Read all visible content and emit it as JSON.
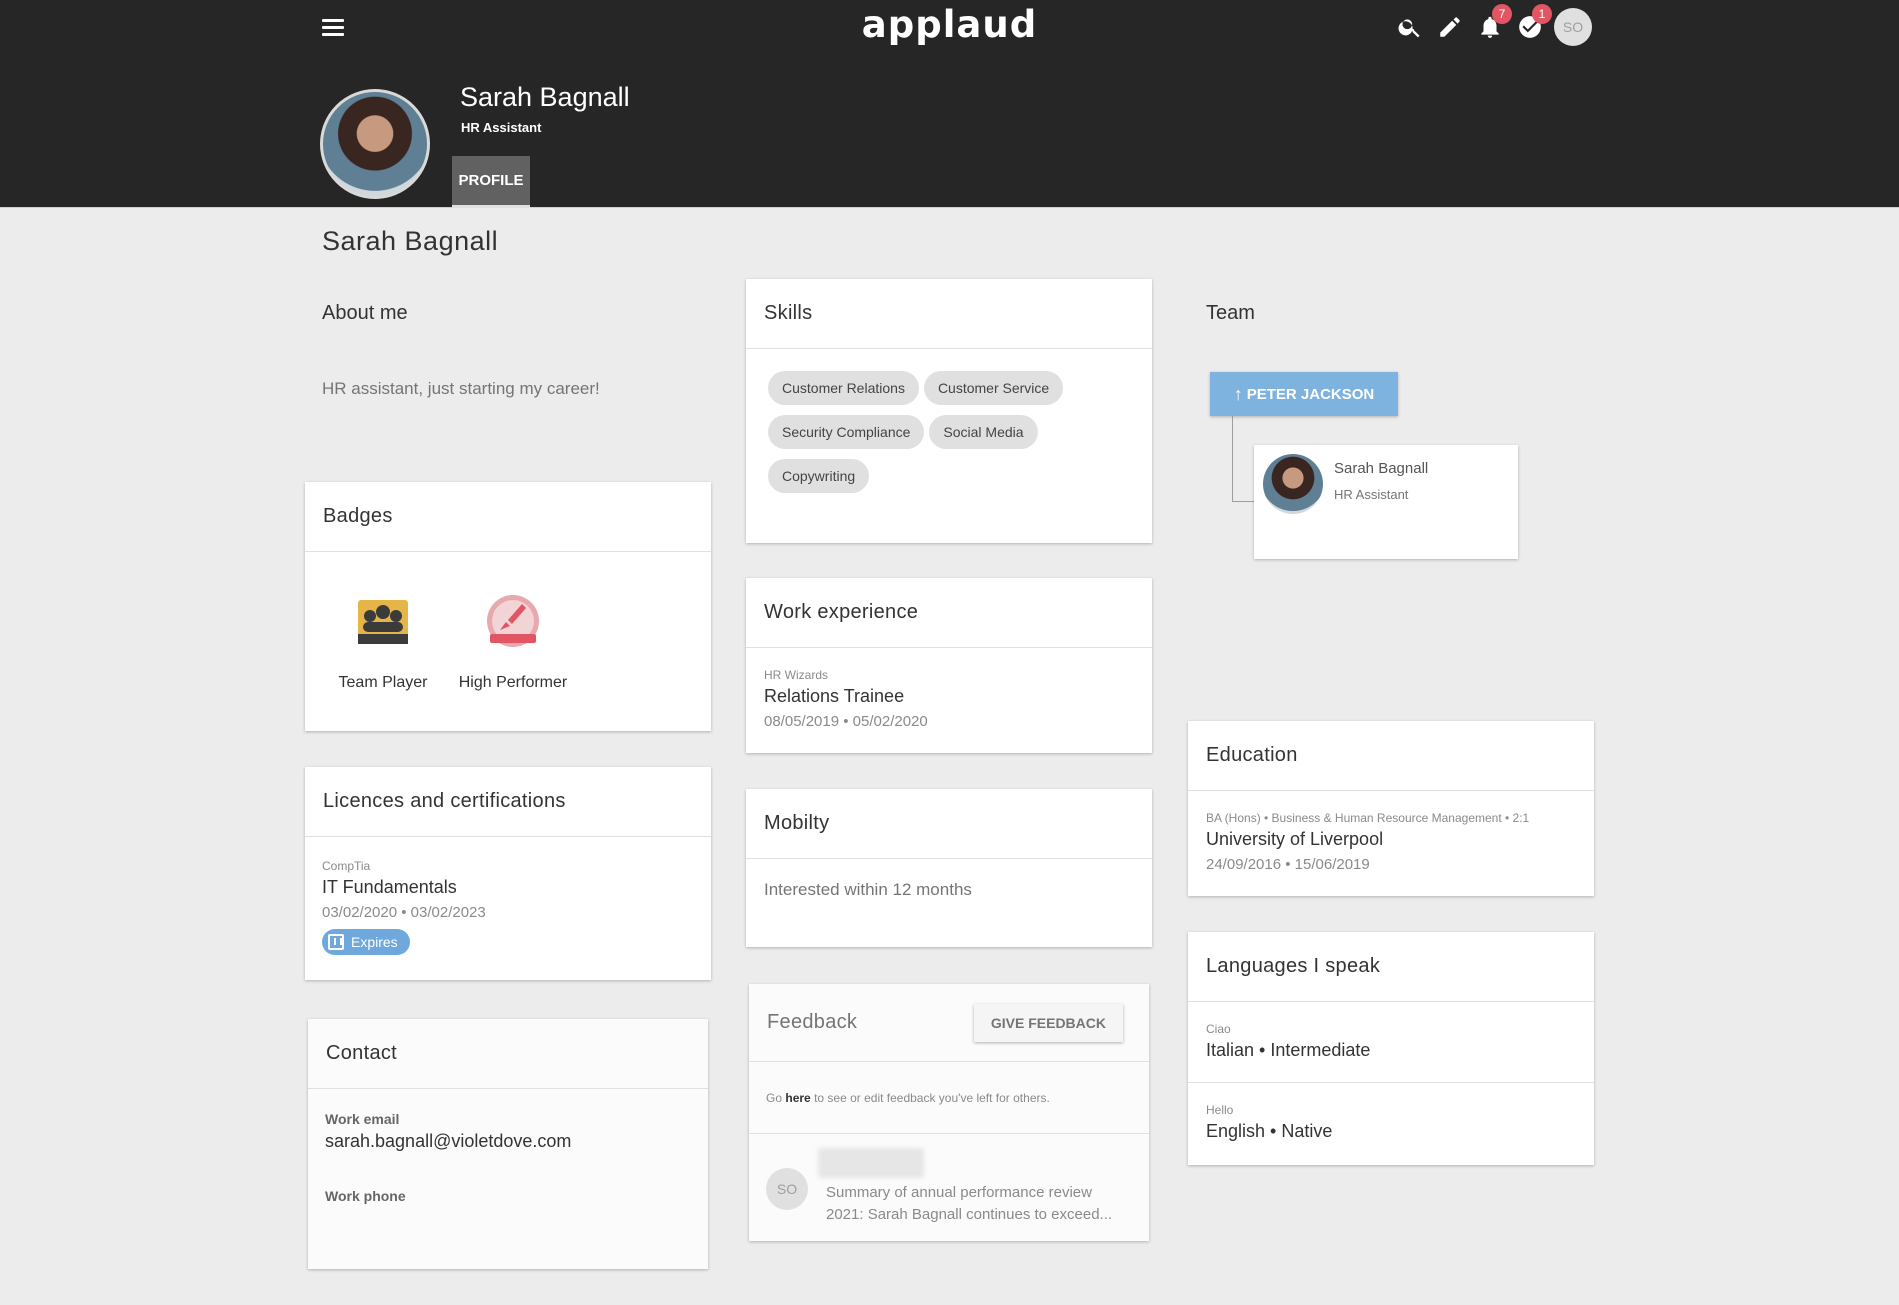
{
  "header": {
    "logo": "applaud",
    "notifications_count": "7",
    "tasks_count": "1",
    "user_initials": "SO"
  },
  "profile": {
    "name": "Sarah Bagnall",
    "role": "HR Assistant",
    "tab_label": "PROFILE"
  },
  "page_title": "Sarah Bagnall",
  "about": {
    "title": "About me",
    "text": "HR assistant, just starting my career!"
  },
  "badges": {
    "title": "Badges",
    "items": [
      {
        "label": "Team Player"
      },
      {
        "label": "High Performer"
      }
    ]
  },
  "licences": {
    "title": "Licences and certifications",
    "issuer": "CompTia",
    "name": "IT Fundamentals",
    "dates": "03/02/2020 • 03/02/2023",
    "pill": "Expires"
  },
  "contact": {
    "title": "Contact",
    "email_label": "Work email",
    "email": "sarah.bagnall@violetdove.com",
    "phone_label": "Work phone"
  },
  "skills": {
    "title": "Skills",
    "items": [
      "Customer Relations",
      "Customer Service",
      "Security Compliance",
      "Social Media",
      "Copywriting"
    ]
  },
  "work": {
    "title": "Work experience",
    "company": "HR Wizards",
    "position": "Relations Trainee",
    "dates": "08/05/2019 • 05/02/2020"
  },
  "mobility": {
    "title": "Mobilty",
    "text": "Interested within 12 months"
  },
  "feedback": {
    "title": "Feedback",
    "button": "GIVE FEEDBACK",
    "hint_prefix": "Go ",
    "hint_link": "here",
    "hint_suffix": " to see or edit feedback you've left for others.",
    "entry_initials": "SO",
    "entry_line1": "Summary of annual performance review",
    "entry_line2": "2021: Sarah Bagnall continues to exceed..."
  },
  "team": {
    "title": "Team",
    "manager": "PETER JACKSON",
    "member_name": "Sarah Bagnall",
    "member_role": "HR Assistant"
  },
  "education": {
    "title": "Education",
    "degree": "BA (Hons) • Business & Human Resource Management • 2:1",
    "school": "University of Liverpool",
    "dates": "24/09/2016 • 15/06/2019"
  },
  "languages": {
    "title": "Languages I speak",
    "items": [
      {
        "greeting": "Ciao",
        "language": "Italian • Intermediate"
      },
      {
        "greeting": "Hello",
        "language": "English • Native"
      }
    ]
  },
  "colors": {
    "header_bg": "#262626",
    "accent_blue": "#7eb3e0",
    "notification_red": "#e25563",
    "page_bg": "#ececec"
  }
}
